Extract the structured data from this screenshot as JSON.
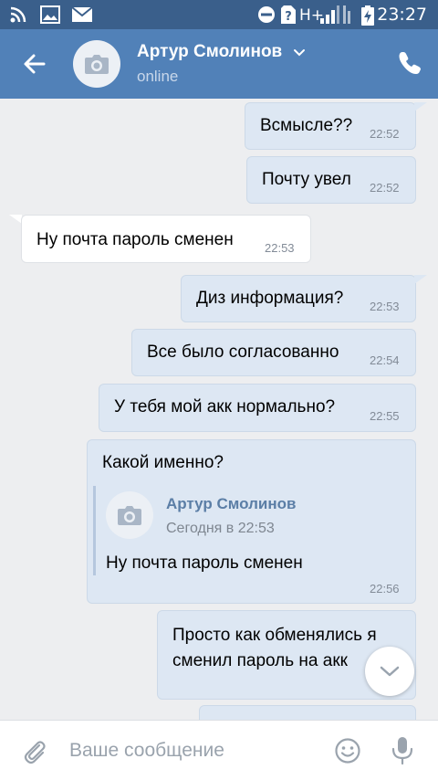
{
  "status_bar": {
    "time": "23:27",
    "network": "H+",
    "icons": [
      "wifi-icon",
      "image-icon",
      "mail-icon",
      "do-not-disturb-icon",
      "no-sim-icon",
      "signal-icon",
      "battery-charging-icon"
    ]
  },
  "header": {
    "contact_name": "Артур Смолинов",
    "contact_status": "online",
    "icons": [
      "back-arrow-icon",
      "camera-icon",
      "chevron-down-icon",
      "phone-icon"
    ]
  },
  "messages": [
    {
      "direction": "out",
      "text": "Всмысле??",
      "time": "22:52"
    },
    {
      "direction": "out",
      "text": "Почту увел",
      "time": "22:52"
    },
    {
      "direction": "in",
      "text": "Ну почта пароль сменен",
      "time": "22:53"
    },
    {
      "direction": "out",
      "text": "Диз информация?",
      "time": "22:53"
    },
    {
      "direction": "out",
      "text": "Все было согласованно",
      "time": "22:54"
    },
    {
      "direction": "out",
      "text": "У тебя мой акк нормально?",
      "time": "22:55"
    },
    {
      "direction": "out",
      "text": "Какой именно?",
      "time": "22:56",
      "forwarded": {
        "author": "Артур Смолинов",
        "date": "Сегодня в 22:53",
        "text": "Ну почта пароль сменен"
      }
    },
    {
      "direction": "out",
      "text_lines": [
        "Просто как обменялись я",
        "сменил пароль на акк"
      ]
    }
  ],
  "composer": {
    "placeholder": "Ваше сообщение",
    "icons": [
      "paperclip-icon",
      "emoji-icon",
      "microphone-icon"
    ]
  },
  "colors": {
    "status_bar": "#3a5f8b",
    "header": "#5181b8",
    "background": "#edeef0",
    "outgoing_bubble": "#dde7f3",
    "incoming_bubble": "#ffffff",
    "quote_name": "#5b7ea6"
  }
}
